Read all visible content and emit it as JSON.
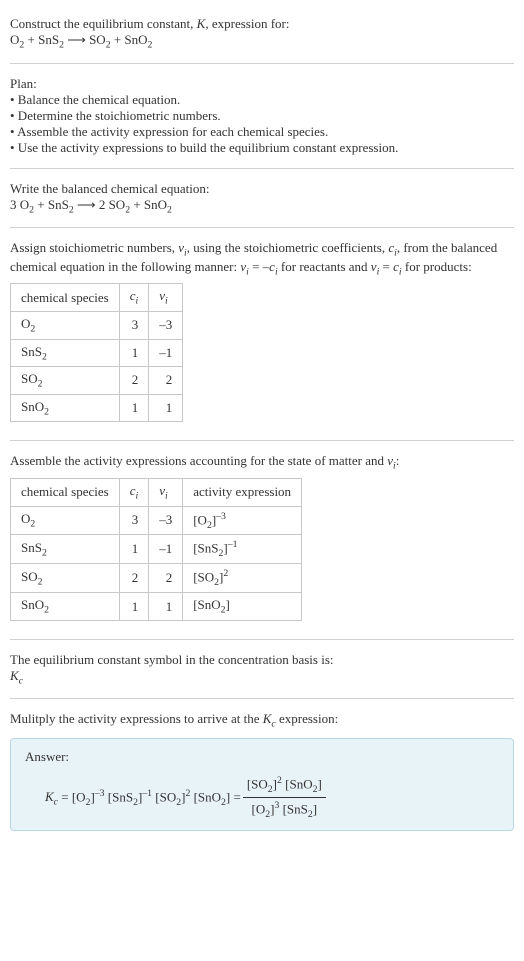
{
  "header": {
    "line1": "Construct the equilibrium constant, <span class='ital'>K</span>, expression for:",
    "eq": "O<sub>2</sub> + SnS<sub>2</sub>&nbsp;<span class='arrow'>⟶</span>&nbsp;SO<sub>2</sub> + SnO<sub>2</sub>"
  },
  "plan": {
    "title": "Plan:",
    "items": [
      "• Balance the chemical equation.",
      "• Determine the stoichiometric numbers.",
      "• Assemble the activity expression for each chemical species.",
      "• Use the activity expressions to build the equilibrium constant expression."
    ]
  },
  "balanced": {
    "title": "Write the balanced chemical equation:",
    "eq": "3 O<sub>2</sub> + SnS<sub>2</sub>&nbsp;<span class='arrow'>⟶</span>&nbsp;2 SO<sub>2</sub> + SnO<sub>2</sub>"
  },
  "assign": {
    "text": "Assign stoichiometric numbers, <span class='ital'>ν<sub>i</sub></span>, using the stoichiometric coefficients, <span class='ital'>c<sub>i</sub></span>, from the balanced chemical equation in the following manner: <span class='ital'>ν<sub>i</sub></span> = –<span class='ital'>c<sub>i</sub></span> for reactants and <span class='ital'>ν<sub>i</sub></span> = <span class='ital'>c<sub>i</sub></span> for products:",
    "headers": [
      "chemical species",
      "<span class='ital'>c<sub>i</sub></span>",
      "<span class='ital'>ν<sub>i</sub></span>"
    ],
    "rows": [
      {
        "sp": "O<sub>2</sub>",
        "c": "3",
        "v": "–3"
      },
      {
        "sp": "SnS<sub>2</sub>",
        "c": "1",
        "v": "–1"
      },
      {
        "sp": "SO<sub>2</sub>",
        "c": "2",
        "v": "2"
      },
      {
        "sp": "SnO<sub>2</sub>",
        "c": "1",
        "v": "1"
      }
    ]
  },
  "activity": {
    "text": "Assemble the activity expressions accounting for the state of matter and <span class='ital'>ν<sub>i</sub></span>:",
    "headers": [
      "chemical species",
      "<span class='ital'>c<sub>i</sub></span>",
      "<span class='ital'>ν<sub>i</sub></span>",
      "activity expression"
    ],
    "rows": [
      {
        "sp": "O<sub>2</sub>",
        "c": "3",
        "v": "–3",
        "a": "[O<sub>2</sub>]<sup>–3</sup>"
      },
      {
        "sp": "SnS<sub>2</sub>",
        "c": "1",
        "v": "–1",
        "a": "[SnS<sub>2</sub>]<sup>–1</sup>"
      },
      {
        "sp": "SO<sub>2</sub>",
        "c": "2",
        "v": "2",
        "a": "[SO<sub>2</sub>]<sup>2</sup>"
      },
      {
        "sp": "SnO<sub>2</sub>",
        "c": "1",
        "v": "1",
        "a": "[SnO<sub>2</sub>]"
      }
    ]
  },
  "basis": {
    "line1": "The equilibrium constant symbol in the concentration basis is:",
    "line2": "<span class='ital'>K<sub>c</sub></span>"
  },
  "mult": {
    "text": "Mulitply the activity expressions to arrive at the <span class='ital'>K<sub>c</sub></span> expression:"
  },
  "answer": {
    "label": "Answer:",
    "lhs": "<span class='ital'>K<sub>c</sub></span> = [O<sub>2</sub>]<sup>–3</sup> [SnS<sub>2</sub>]<sup>–1</sup> [SO<sub>2</sub>]<sup>2</sup> [SnO<sub>2</sub>] = ",
    "frac_num": "[SO<sub>2</sub>]<sup>2</sup> [SnO<sub>2</sub>]",
    "frac_den": "[O<sub>2</sub>]<sup>3</sup> [SnS<sub>2</sub>]"
  }
}
